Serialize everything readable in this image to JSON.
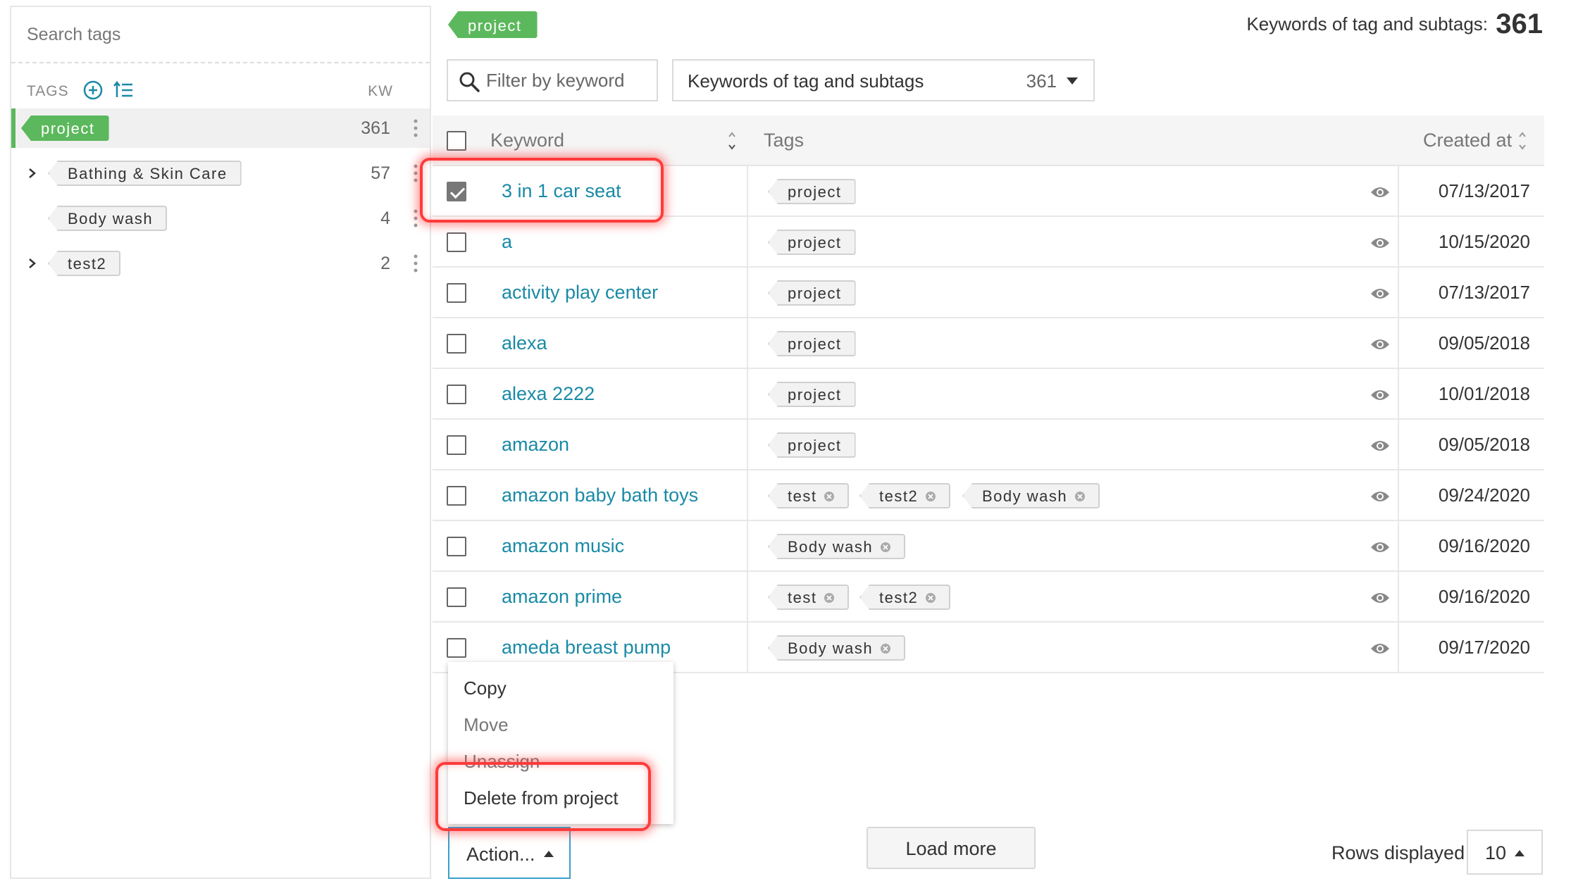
{
  "sidebar": {
    "search_placeholder": "Search tags",
    "tags_label": "TAGS",
    "kw_label": "KW",
    "add_icon": "plus-circle-icon",
    "sort_icon": "sort-list-icon",
    "items": [
      {
        "label": "project",
        "count": "361",
        "active": true,
        "expandable": false
      },
      {
        "label": "Bathing & Skin Care",
        "count": "57",
        "active": false,
        "expandable": true
      },
      {
        "label": "Body wash",
        "count": "4",
        "active": false,
        "expandable": false
      },
      {
        "label": "test2",
        "count": "2",
        "active": false,
        "expandable": true
      }
    ]
  },
  "header": {
    "current_tag": "project",
    "total_label": "Keywords of tag and subtags:",
    "total_value": "361"
  },
  "filters": {
    "keyword_placeholder": "Filter by keyword",
    "scope_label": "Keywords of tag and subtags",
    "scope_count": "361"
  },
  "table": {
    "columns": {
      "keyword": "Keyword",
      "tags": "Tags",
      "created": "Created at"
    },
    "rows": [
      {
        "keyword": "3 in 1 car seat",
        "checked": true,
        "tags": [
          {
            "label": "project",
            "removable": false
          }
        ],
        "created": "07/13/2017"
      },
      {
        "keyword": "a",
        "checked": false,
        "tags": [
          {
            "label": "project",
            "removable": false
          }
        ],
        "created": "10/15/2020"
      },
      {
        "keyword": "activity play center",
        "checked": false,
        "tags": [
          {
            "label": "project",
            "removable": false
          }
        ],
        "created": "07/13/2017"
      },
      {
        "keyword": "alexa",
        "checked": false,
        "tags": [
          {
            "label": "project",
            "removable": false
          }
        ],
        "created": "09/05/2018"
      },
      {
        "keyword": "alexa 2222",
        "checked": false,
        "tags": [
          {
            "label": "project",
            "removable": false
          }
        ],
        "created": "10/01/2018"
      },
      {
        "keyword": "amazon",
        "checked": false,
        "tags": [
          {
            "label": "project",
            "removable": false
          }
        ],
        "created": "09/05/2018"
      },
      {
        "keyword": "amazon baby bath toys",
        "checked": false,
        "tags": [
          {
            "label": "test",
            "removable": true
          },
          {
            "label": "test2",
            "removable": true
          },
          {
            "label": "Body wash",
            "removable": true
          }
        ],
        "created": "09/24/2020"
      },
      {
        "keyword": "amazon music",
        "checked": false,
        "tags": [
          {
            "label": "Body wash",
            "removable": true
          }
        ],
        "created": "09/16/2020"
      },
      {
        "keyword": "amazon prime",
        "checked": false,
        "tags": [
          {
            "label": "test",
            "removable": true
          },
          {
            "label": "test2",
            "removable": true
          }
        ],
        "created": "09/16/2020"
      },
      {
        "keyword": "ameda breast pump",
        "checked": false,
        "tags": [
          {
            "label": "Body wash",
            "removable": true
          }
        ],
        "created": "09/17/2020"
      }
    ]
  },
  "action_menu": {
    "items": [
      "Copy",
      "Move",
      "Unassign",
      "Delete from project"
    ],
    "button_label": "Action..."
  },
  "footer": {
    "load_more": "Load more",
    "rows_label": "Rows displayed",
    "rows_value": "10"
  },
  "colors": {
    "accent_green": "#5cb85c",
    "link_teal": "#1a8aa6",
    "highlight_red": "#ff3b3b",
    "action_border_blue": "#3b9ecb"
  }
}
